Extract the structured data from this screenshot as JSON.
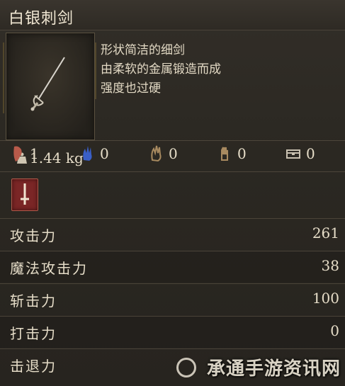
{
  "item": {
    "name": "白银刺剑",
    "weight": "1.44 kg",
    "description": [
      "形状简洁的细剑",
      "由柔软的金属锻造而成",
      "强度也过硬"
    ]
  },
  "requirements": [
    {
      "icon": "strength-icon",
      "value": "1",
      "color": "#b85a4a"
    },
    {
      "icon": "dexterity-icon",
      "value": "0",
      "color": "#3a5fc8"
    },
    {
      "icon": "intelligence-icon",
      "value": "0",
      "color": "#a88a60"
    },
    {
      "icon": "faith-icon",
      "value": "0",
      "color": "#a88a60"
    },
    {
      "icon": "arcane-icon",
      "value": "0",
      "color": "#c8c0b0"
    }
  ],
  "weapon_type_icon": "sword-badge-icon",
  "stats": [
    {
      "label": "攻击力",
      "value": "261"
    },
    {
      "label": "魔法攻击力",
      "value": "38"
    },
    {
      "label": "斩击力",
      "value": "100"
    },
    {
      "label": "打击力",
      "value": "0"
    },
    {
      "label": "击退力",
      "value": ""
    }
  ],
  "watermark": "承通手游资讯网"
}
